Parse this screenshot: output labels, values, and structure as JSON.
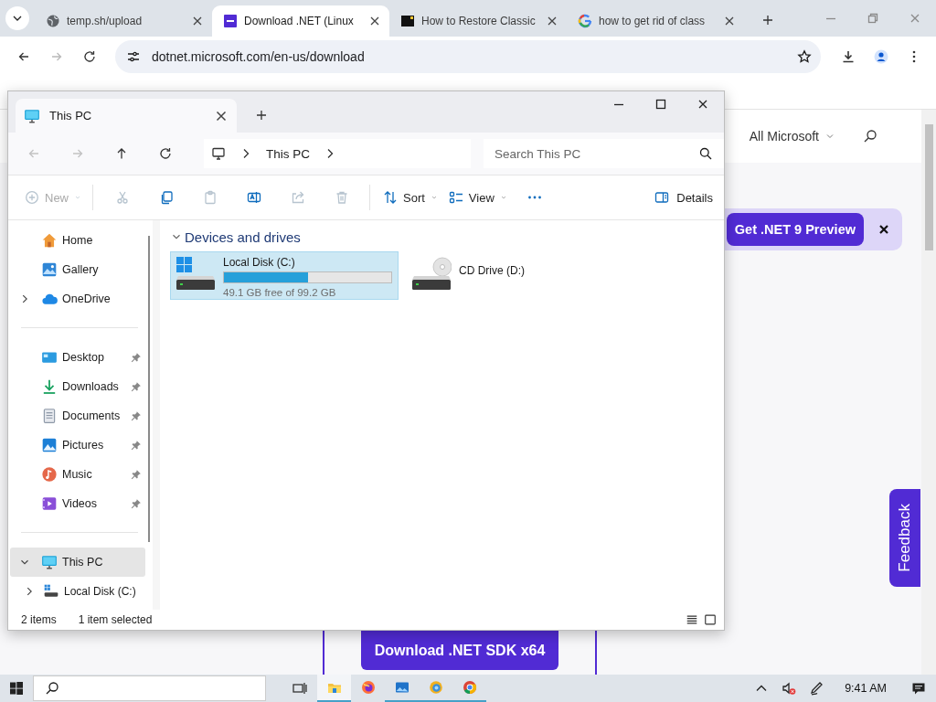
{
  "browser": {
    "tabs": [
      {
        "title": "temp.sh/upload",
        "kind": "globe",
        "selected": false
      },
      {
        "title": "Download .NET (Linux",
        "kind": "dotnet",
        "selected": true
      },
      {
        "title": "How to Restore Classic",
        "kind": "wiki",
        "selected": false
      },
      {
        "title": "how to get rid of class",
        "kind": "google",
        "selected": false
      }
    ],
    "nav": [
      {
        "kind": "back",
        "disabled": false
      },
      {
        "kind": "forward",
        "disabled": true
      },
      {
        "kind": "reload",
        "disabled": false
      }
    ],
    "address": "dotnet.microsoft.com/en-us/download"
  },
  "page": {
    "nav_menu": "All Microsoft",
    "banner_button": "Get .NET 9 Preview",
    "download_button": "Download .NET SDK x64",
    "feedback": "Feedback"
  },
  "explorer": {
    "tab_title": "This PC",
    "nav": [
      {
        "kind": "back",
        "disabled": true
      },
      {
        "kind": "forward",
        "disabled": true
      },
      {
        "kind": "up",
        "disabled": false
      },
      {
        "kind": "refresh",
        "disabled": false
      }
    ],
    "breadcrumb": [
      "This PC"
    ],
    "search": {
      "placeholder": "Search This PC"
    },
    "commands": [
      {
        "kind": "new",
        "label": "New",
        "disabled": true
      },
      {
        "kind": "cut",
        "disabled": true
      },
      {
        "kind": "copy",
        "disabled": false
      },
      {
        "kind": "paste",
        "disabled": true
      },
      {
        "kind": "rename",
        "disabled": false
      },
      {
        "kind": "share",
        "disabled": true
      },
      {
        "kind": "delete",
        "disabled": true
      },
      {
        "kind": "sort",
        "label": "Sort",
        "disabled": false
      },
      {
        "kind": "view",
        "label": "View",
        "disabled": false
      },
      {
        "kind": "more",
        "disabled": false
      }
    ],
    "details": "Details",
    "sidebar": {
      "groups": [
        [
          {
            "label": "Home",
            "kind": "home",
            "selected": false
          },
          {
            "label": "Gallery",
            "kind": "gallery",
            "selected": false
          },
          {
            "label": "OneDrive",
            "kind": "cloud",
            "selected": false,
            "expanded": false
          }
        ],
        [
          {
            "label": "Desktop",
            "kind": "desktop",
            "pinned": true,
            "selected": false
          },
          {
            "label": "Downloads",
            "kind": "downloads",
            "pinned": true,
            "selected": false
          },
          {
            "label": "Documents",
            "kind": "documents",
            "pinned": true,
            "selected": false
          },
          {
            "label": "Pictures",
            "kind": "pictures",
            "pinned": true,
            "selected": false
          },
          {
            "label": "Music",
            "kind": "music",
            "pinned": true,
            "selected": false
          },
          {
            "label": "Videos",
            "kind": "videos",
            "pinned": true,
            "selected": false
          }
        ],
        [
          {
            "label": "This PC",
            "kind": "thispc",
            "selected": true,
            "expanded": true,
            "children": [
              {
                "label": "Local Disk (C:)",
                "kind": "disk",
                "selected": false,
                "expanded": false
              }
            ]
          }
        ]
      ]
    },
    "group": {
      "title": "Devices and drives",
      "expanded": true
    },
    "drives": [
      {
        "name": "Local Disk (C:)",
        "kind": "system",
        "selected": true,
        "level": 0.505,
        "free": "49.1 GB free of 99.2 GB"
      },
      {
        "name": "CD Drive (D:)",
        "kind": "cd",
        "selected": false
      }
    ],
    "status": {
      "count": "2 items",
      "selection": "1 item selected"
    }
  },
  "taskbar": {
    "apps": [
      {
        "kind": "explorer",
        "selected": true,
        "running": true
      },
      {
        "kind": "firefox",
        "selected": false,
        "running": false
      },
      {
        "kind": "photos",
        "selected": false,
        "running": true
      },
      {
        "kind": "app",
        "selected": false,
        "running": true
      },
      {
        "kind": "chrome",
        "selected": false,
        "running": true
      }
    ],
    "time": "9:41 AM"
  }
}
